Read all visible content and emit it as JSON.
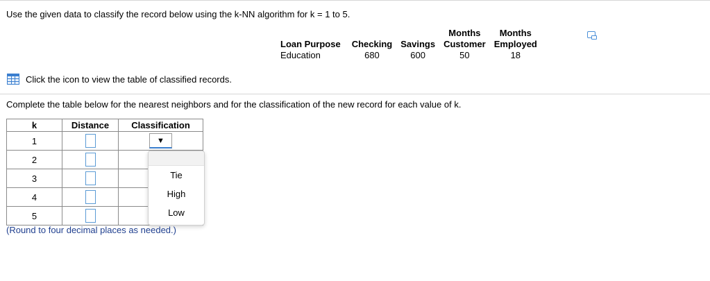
{
  "question": "Use the given data to classify the record below using the k-NN algorithm for k = 1 to 5.",
  "record": {
    "headers": [
      {
        "line1": "",
        "line2": "Loan Purpose"
      },
      {
        "line1": "",
        "line2": "Checking"
      },
      {
        "line1": "",
        "line2": "Savings"
      },
      {
        "line1": "Months",
        "line2": "Customer"
      },
      {
        "line1": "Months",
        "line2": "Employed"
      }
    ],
    "values": [
      "Education",
      "680",
      "600",
      "50",
      "18"
    ]
  },
  "icon_link_text": "Click the icon to view the table of classified records.",
  "instruction": "Complete the table below for the nearest neighbors and for the classification of the new record for each value of k.",
  "nn_table": {
    "headers": [
      "k",
      "Distance",
      "Classification"
    ],
    "rows": [
      {
        "k": "1"
      },
      {
        "k": "2"
      },
      {
        "k": "3"
      },
      {
        "k": "4"
      },
      {
        "k": "5"
      }
    ]
  },
  "dropdown": {
    "arrow": "▼",
    "options": [
      "Tie",
      "High",
      "Low"
    ]
  },
  "note": "(Round to four decimal places as needed.)",
  "colors": {
    "accent": "#3b7fcf",
    "note_text": "#1f3f8f"
  }
}
